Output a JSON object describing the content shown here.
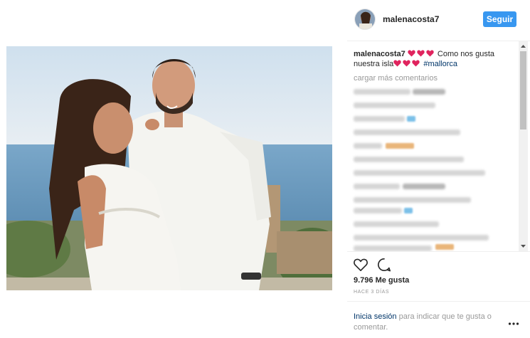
{
  "post": {
    "username": "malenacosta7",
    "follow_label": "Seguir",
    "caption": {
      "username": "malenacosta7",
      "text_part1": "Como nos gusta nuestra isla",
      "hashtag": "#mallorca"
    },
    "load_more_label": "cargar más comentarios",
    "likes": "9.796 Me gusta",
    "time": "HACE 3 DÍAS",
    "login_link": "Inicia sesión",
    "login_text": "para indicar que te gusta o comentar."
  },
  "icons": {
    "like": "heart-outline-icon",
    "comment": "comment-bubble-icon",
    "more": "more-options-icon",
    "emoji": "red-heart-emoji"
  },
  "colors": {
    "accent": "#3897f0",
    "link": "#003569",
    "heart_emoji": "#e0245e"
  }
}
